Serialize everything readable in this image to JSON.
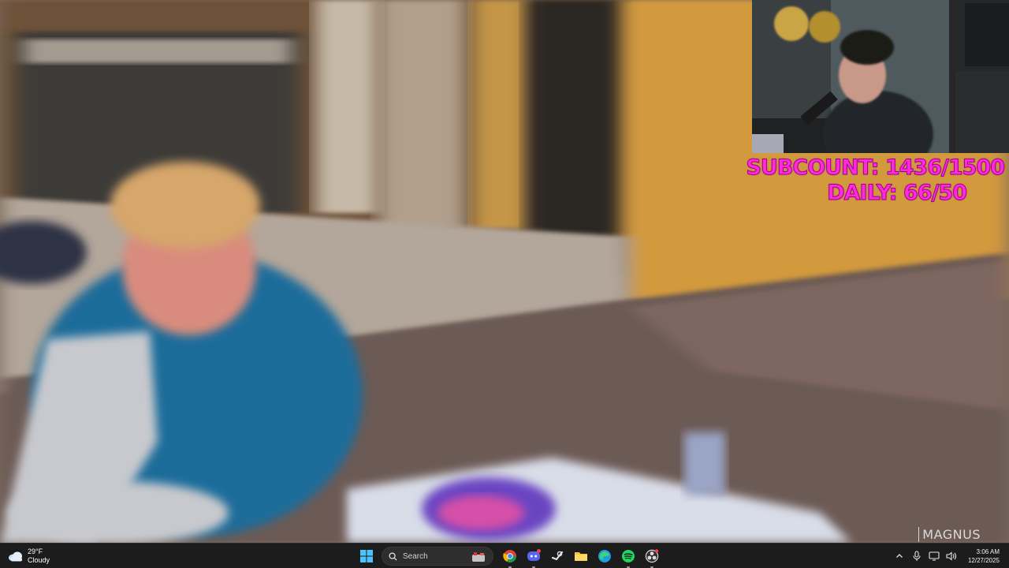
{
  "overlay": {
    "sub_count": "SUBCOUNT: 1436/1500",
    "daily_count": "DAILY: 66/50",
    "watermark": "MAGNUS",
    "accent_color": "#ff2bd6"
  },
  "taskbar": {
    "weather": {
      "temperature": "29°F",
      "condition": "Cloudy",
      "icon": "cloud-icon"
    },
    "search": {
      "label": "Search",
      "icon": "search-icon"
    },
    "apps": [
      {
        "name": "start",
        "icon": "windows-start-icon"
      },
      {
        "name": "chrome",
        "icon": "chrome-icon"
      },
      {
        "name": "discord",
        "icon": "discord-icon"
      },
      {
        "name": "steam",
        "icon": "steam-icon"
      },
      {
        "name": "file-explorer",
        "icon": "folder-icon"
      },
      {
        "name": "edge",
        "icon": "edge-icon"
      },
      {
        "name": "spotify",
        "icon": "spotify-icon"
      },
      {
        "name": "obs",
        "icon": "obs-icon"
      }
    ],
    "tray": {
      "icons": [
        "chevron-up-icon",
        "microphone-icon",
        "display-icon",
        "speaker-icon"
      ]
    },
    "clock": {
      "time": "3:06 AM",
      "date": "12/27/2025"
    }
  }
}
